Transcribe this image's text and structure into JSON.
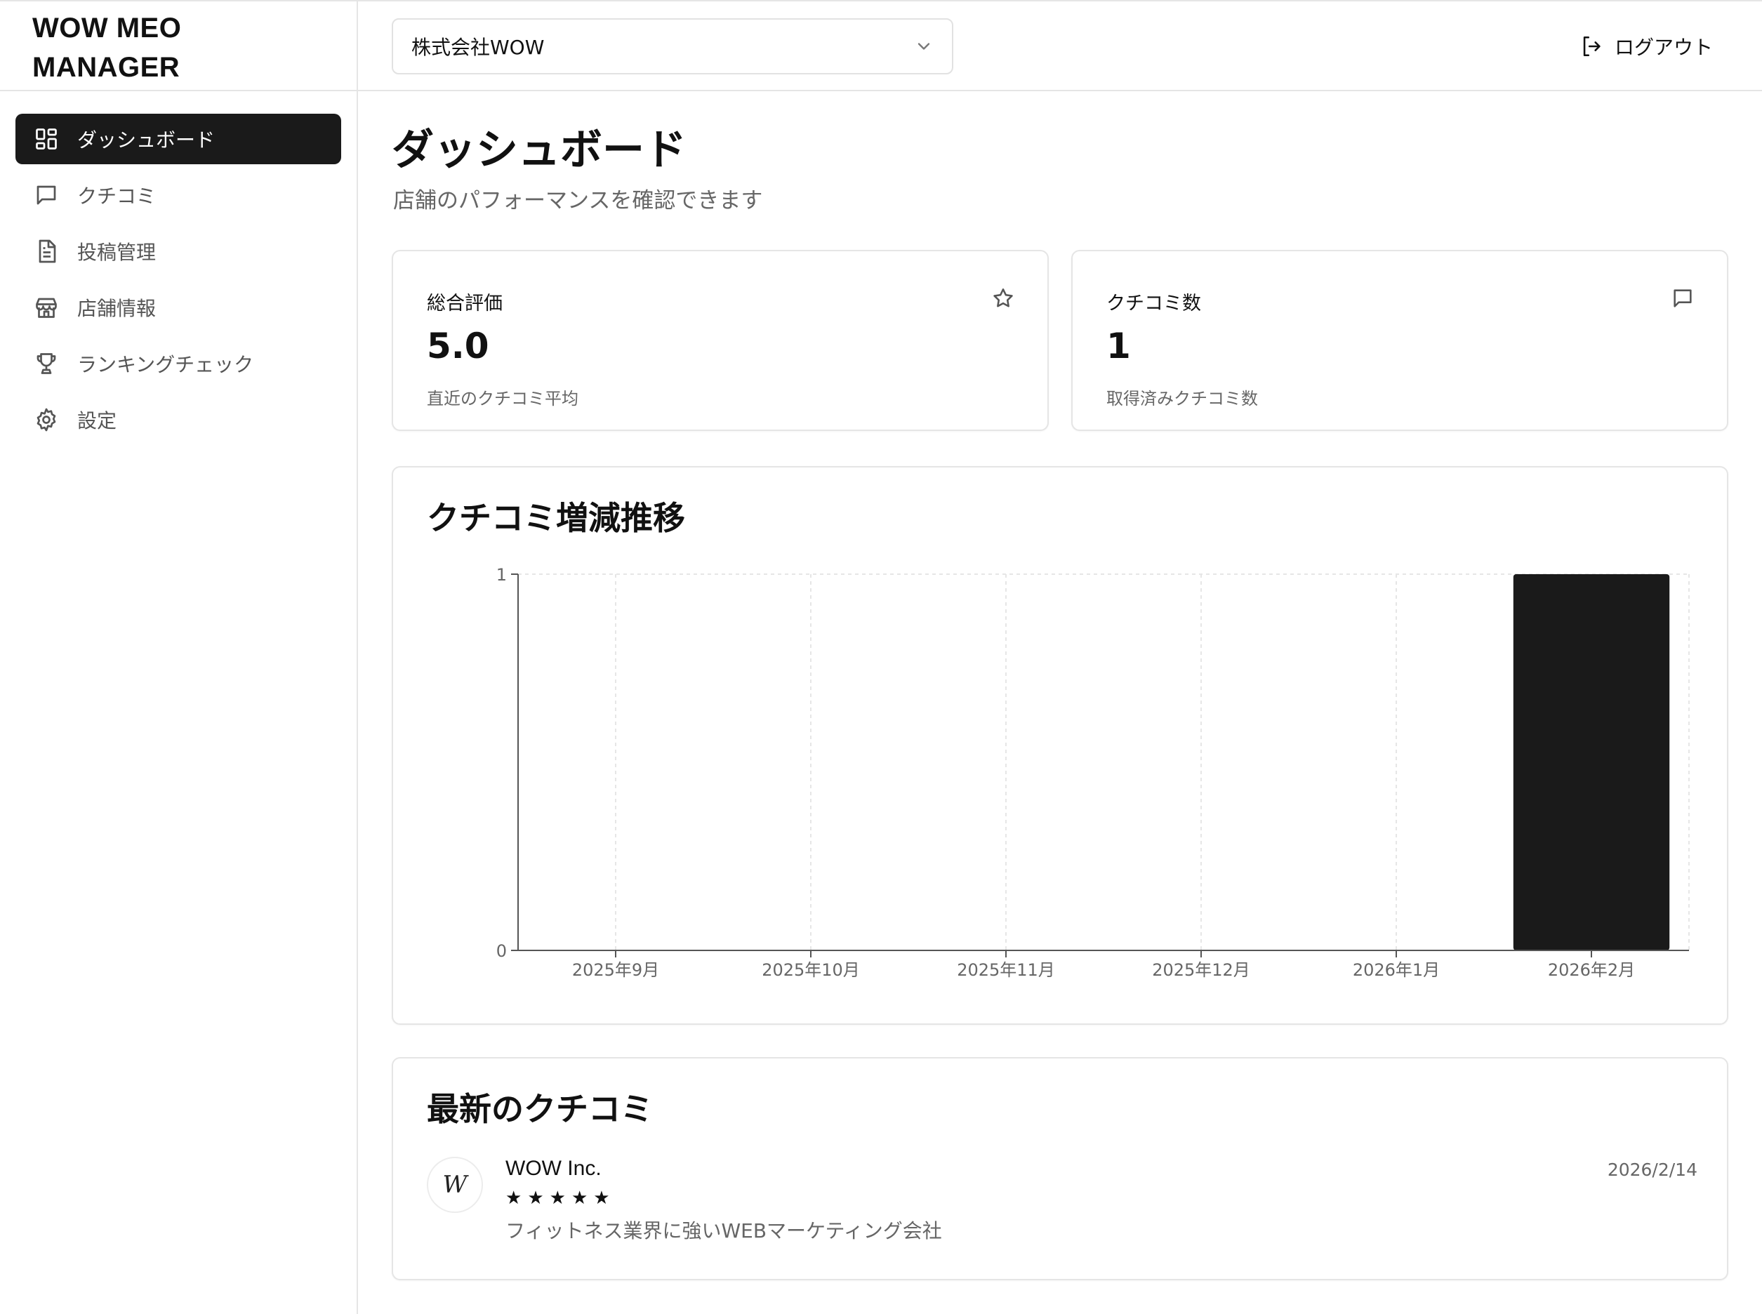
{
  "app": {
    "title": "WOW MEO MANAGER"
  },
  "sidebar": {
    "items": [
      {
        "label": "ダッシュボード",
        "icon": "dashboard-grid-icon",
        "active": true
      },
      {
        "label": "クチコミ",
        "icon": "message-icon",
        "active": false
      },
      {
        "label": "投稿管理",
        "icon": "document-icon",
        "active": false
      },
      {
        "label": "店舗情報",
        "icon": "store-icon",
        "active": false
      },
      {
        "label": "ランキングチェック",
        "icon": "trophy-icon",
        "active": false
      },
      {
        "label": "設定",
        "icon": "gear-icon",
        "active": false
      }
    ]
  },
  "header": {
    "store_select": {
      "value": "株式会社WOW"
    },
    "logout_label": "ログアウト"
  },
  "page": {
    "title": "ダッシュボード",
    "subtitle": "店舗のパフォーマンスを確認できます"
  },
  "stats": {
    "rating": {
      "label": "総合評価",
      "value": "5.0",
      "sub": "直近のクチコミ平均",
      "icon": "star-icon"
    },
    "reviews": {
      "label": "クチコミ数",
      "value": "1",
      "sub": "取得済みクチコミ数",
      "icon": "message-icon"
    }
  },
  "chart_section": {
    "title": "クチコミ増減推移"
  },
  "chart_data": {
    "type": "bar",
    "categories": [
      "2025年9月",
      "2025年10月",
      "2025年11月",
      "2025年12月",
      "2026年1月",
      "2026年2月"
    ],
    "values": [
      0,
      0,
      0,
      0,
      0,
      1
    ],
    "yticks": [
      "0",
      "1"
    ],
    "ylim": [
      0,
      1
    ],
    "grid": true,
    "bar_color": "#1a1a1a"
  },
  "reviews_section": {
    "title": "最新のクチコミ",
    "items": [
      {
        "avatar": "W",
        "name": "WOW Inc.",
        "stars": 5,
        "text": "フィットネス業界に強いWEBマーケティング会社",
        "date": "2026/2/14"
      }
    ]
  }
}
